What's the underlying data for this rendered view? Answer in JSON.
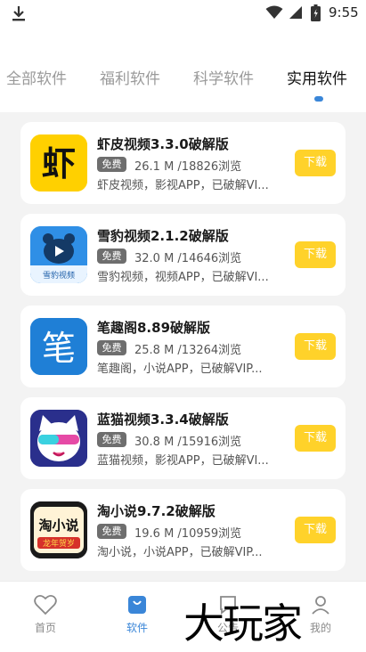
{
  "status_bar": {
    "time": "9:55"
  },
  "tabs": [
    {
      "label": "全部软件",
      "active": false
    },
    {
      "label": "福利软件",
      "active": false
    },
    {
      "label": "科学软件",
      "active": false
    },
    {
      "label": "实用软件",
      "active": true
    }
  ],
  "apps": [
    {
      "title": "虾皮视频3.3.0破解版",
      "badge": "免费",
      "meta": "26.1 M /18826浏览",
      "desc": "虾皮视频，影视APP，已破解VI...",
      "icon_text": "虾",
      "button": "下载"
    },
    {
      "title": "雪豹视频2.1.2破解版",
      "badge": "免费",
      "meta": "32.0 M /14646浏览",
      "desc": "雪豹视频，视频APP，已破解VI...",
      "icon_text": "雪豹视频",
      "button": "下载"
    },
    {
      "title": "笔趣阁8.89破解版",
      "badge": "免费",
      "meta": "25.8 M /13264浏览",
      "desc": "笔趣阁，小说APP，已破解VIP...",
      "icon_text": "笔",
      "button": "下载"
    },
    {
      "title": "蓝猫视频3.3.4破解版",
      "badge": "免费",
      "meta": "30.8 M /15916浏览",
      "desc": "蓝猫视频，影视APP，已破解VI...",
      "icon_text": "",
      "button": "下载"
    },
    {
      "title": "淘小说9.7.2破解版",
      "badge": "免费",
      "meta": "19.6 M /10959浏览",
      "desc": "淘小说，小说APP，已破解VIP...",
      "icon_text": "淘小说",
      "icon_subtext": "龙年贺岁",
      "button": "下载"
    }
  ],
  "bottom_nav": [
    {
      "label": "首页",
      "icon": "heart-icon",
      "active": false
    },
    {
      "label": "软件",
      "icon": "bag-icon",
      "active": true
    },
    {
      "label": "公告",
      "icon": "notice-icon",
      "active": false
    },
    {
      "label": "我的",
      "icon": "user-icon",
      "active": false
    }
  ],
  "watermark": "大玩家",
  "colors": {
    "accent": "#3a86d8",
    "download": "#ffd22a",
    "badge": "#6e6e6e"
  }
}
